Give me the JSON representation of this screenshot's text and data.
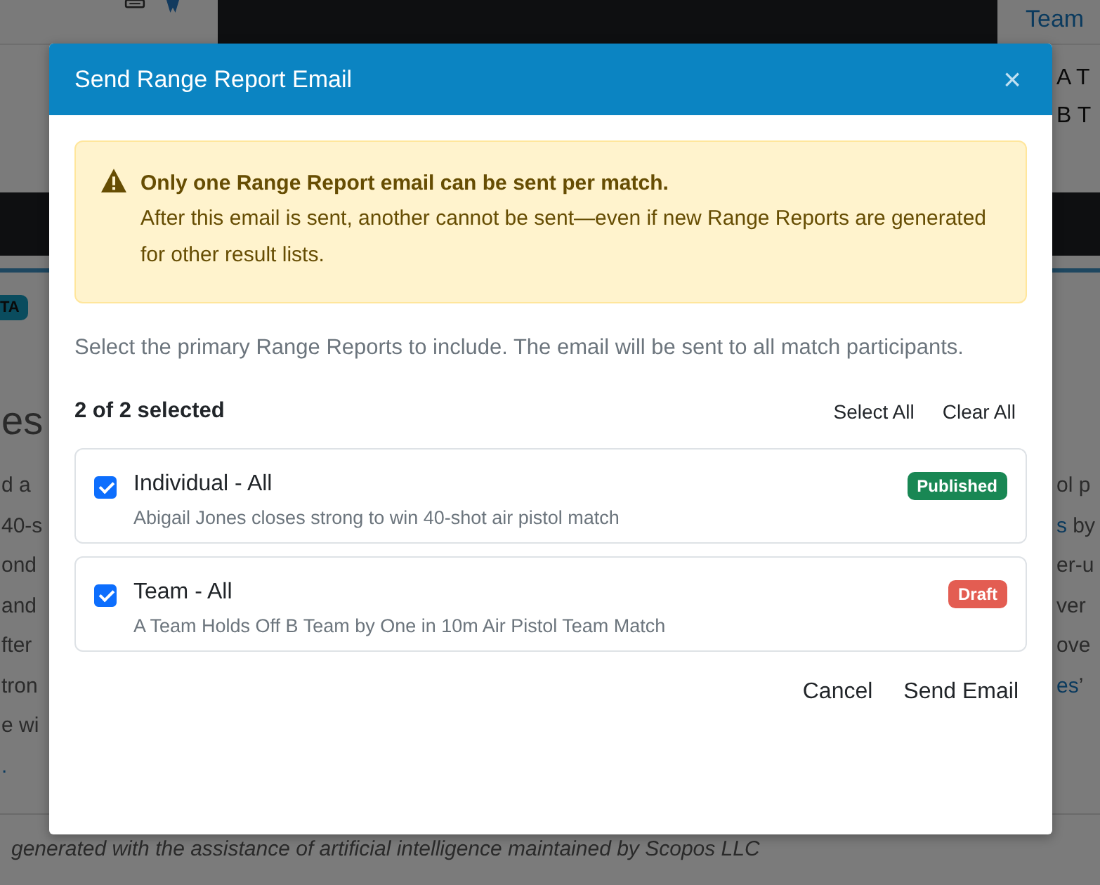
{
  "background_page": {
    "header_link": "Team",
    "team_rows": [
      "A T",
      "B T"
    ],
    "badge": "TA",
    "heading": "es",
    "left_lines": [
      [
        {
          "text": "d a",
          "link": false
        }
      ],
      [
        {
          "text": "40-s",
          "link": false
        }
      ],
      [
        {
          "text": "ond",
          "link": false
        }
      ],
      [
        {
          "text": "and",
          "link": false
        }
      ],
      [
        {
          "text": "fter",
          "link": false
        }
      ],
      [
        {
          "text": "tron",
          "link": false
        }
      ],
      [
        {
          "text": "e wi",
          "link": false
        }
      ],
      [
        {
          "text": ".",
          "link": true
        }
      ]
    ],
    "right_lines": [
      [
        {
          "text": "ol p",
          "link": false
        }
      ],
      [
        {
          "text": "s",
          "link": true
        },
        {
          "text": " by",
          "link": false
        }
      ],
      [
        {
          "text": "er-u",
          "link": false
        }
      ],
      [
        {
          "text": "ver",
          "link": false
        }
      ],
      [
        {
          "text": "ove",
          "link": false
        }
      ],
      [
        {
          "text": "es",
          "link": true
        },
        {
          "text": "’",
          "link": false
        }
      ]
    ],
    "footer": "generated with the assistance of artificial intelligence maintained by Scopos LLC"
  },
  "dialog": {
    "title": "Send Range Report Email",
    "close": "×",
    "alert": {
      "title": "Only one Range Report email can be sent per match.",
      "text": "After this email is sent, another cannot be sent—even if new Range Reports are generated for other result lists."
    },
    "instructions": "Select the primary Range Reports to include. The email will be sent to all match participants.",
    "selection_count": "2 of 2 selected",
    "select_all": "Select All",
    "clear_all": "Clear All",
    "reports": [
      {
        "title": "Individual - All",
        "summary": "Abigail Jones closes strong to win 40-shot air pistol match",
        "checked": true,
        "status": {
          "text": "Published",
          "color": "#198754"
        }
      },
      {
        "title": "Team - All",
        "summary": "A Team Holds Off B Team by One in 10m Air Pistol Team Match",
        "checked": true,
        "status": {
          "text": "Draft",
          "color": "#e35d52"
        }
      }
    ],
    "buttons": [
      "Cancel",
      "Send Email"
    ]
  }
}
